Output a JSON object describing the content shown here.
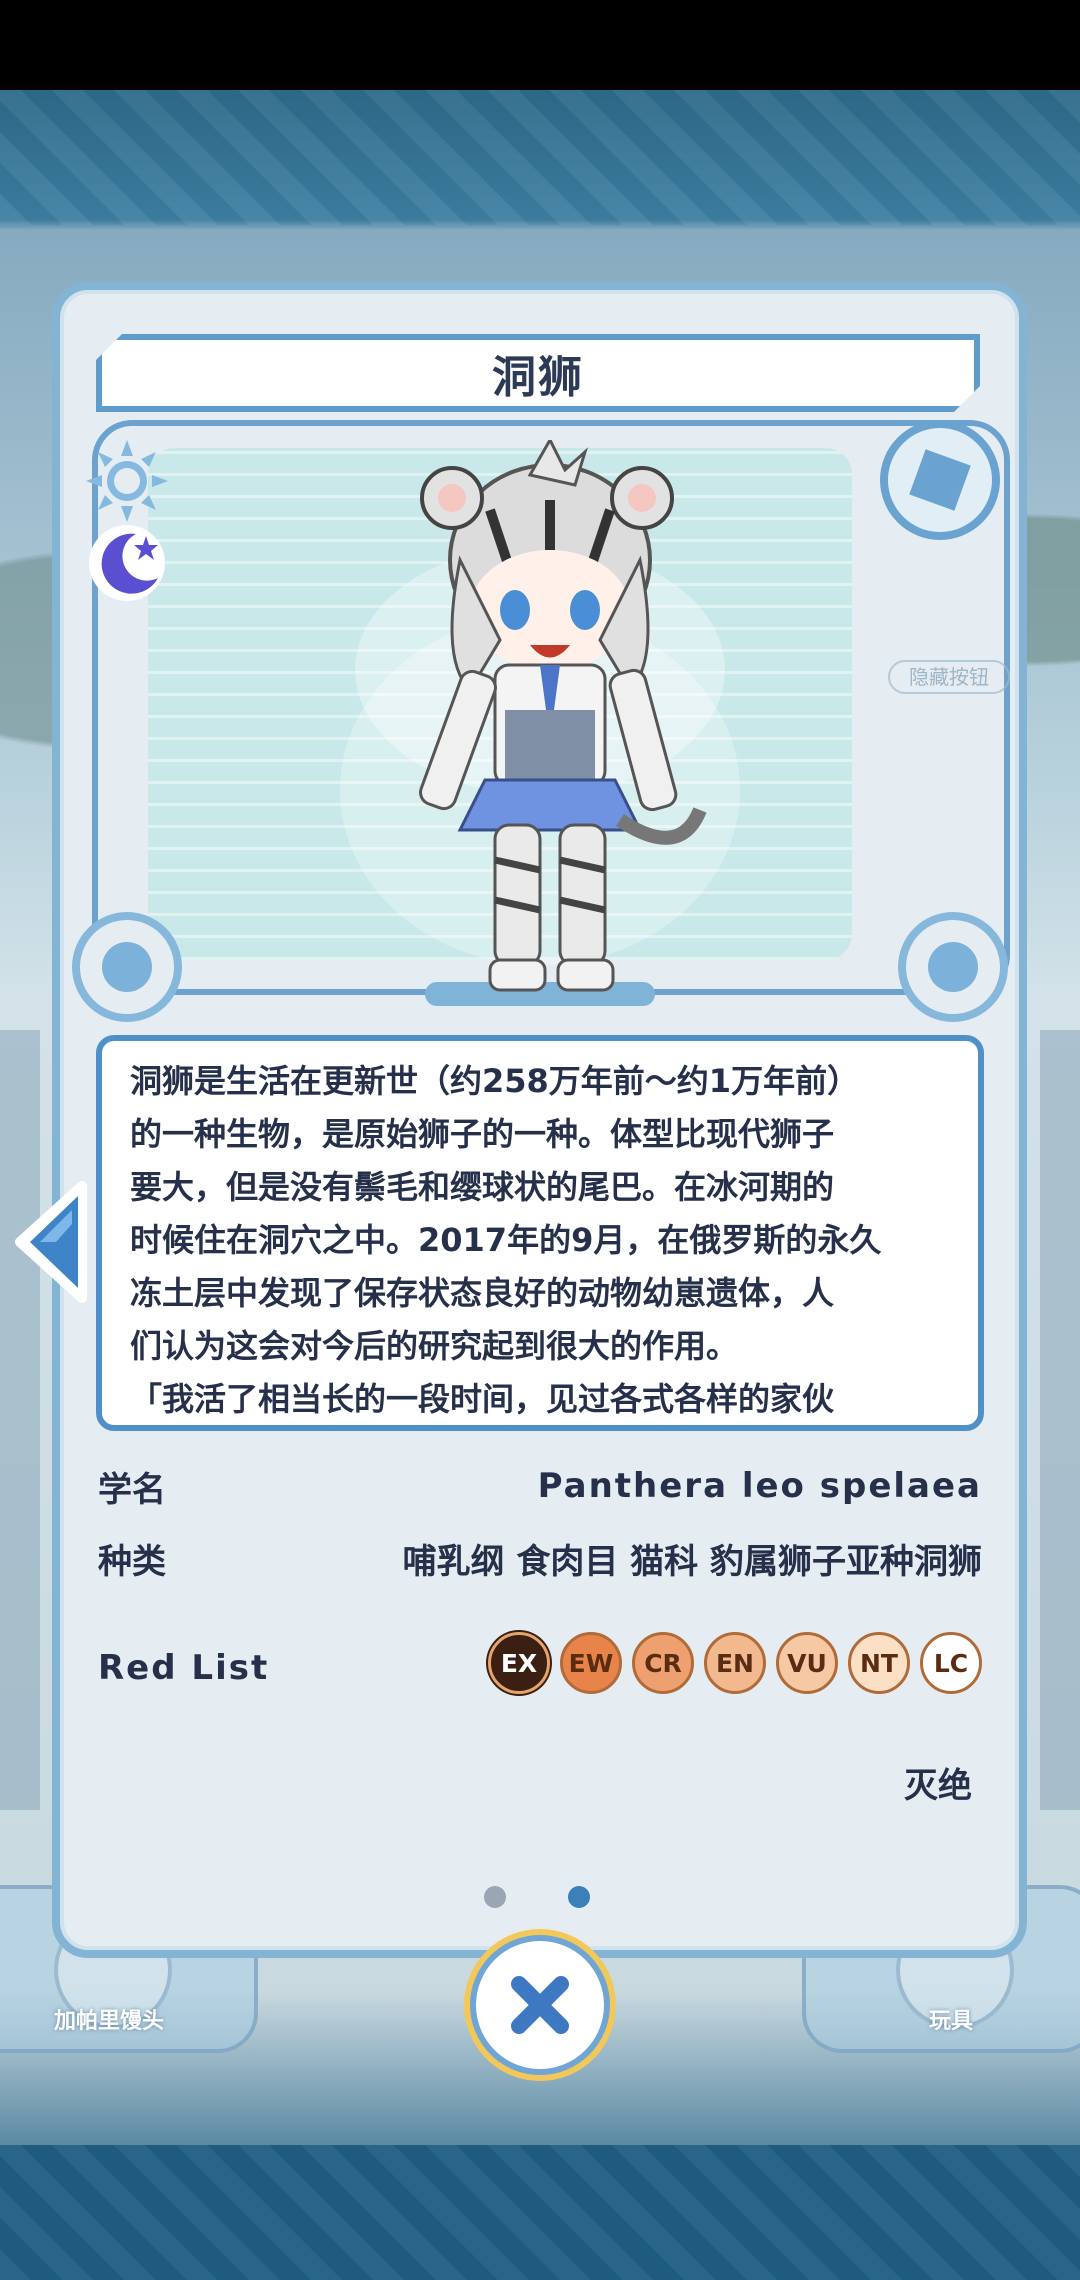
{
  "title": "洞狮",
  "description_lines": [
    "洞狮是生活在更新世（约258万年前～约1万年前）",
    "的一种生物，是原始狮子的一种。体型比现代狮子",
    "要大，但是没有鬃毛和缨球状的尾巴。在冰河期的",
    "时候住在洞穴之中。2017年的9月，在俄罗斯的永久",
    "冻土层中发现了保存状态良好的动物幼崽遗体，人",
    "们认为这会对今后的研究起到很大的作用。",
    "「我活了相当长的一段时间，见过各式各样的家伙"
  ],
  "scientific_name": {
    "label": "学名",
    "value": "Panthera leo spelaea"
  },
  "classification": {
    "label": "种类",
    "value": "哺乳纲 食肉目 猫科 豹属狮子亚种洞狮"
  },
  "red_list": {
    "label": "Red List",
    "status": "灭绝",
    "selected": "EX",
    "categories": [
      {
        "code": "EX",
        "bg": "#3a1f12",
        "fg": "#ffffff"
      },
      {
        "code": "EW",
        "bg": "#e8834a",
        "fg": "#5a2d12"
      },
      {
        "code": "CR",
        "bg": "#eea071",
        "fg": "#5a2d12"
      },
      {
        "code": "EN",
        "bg": "#f2b88e",
        "fg": "#5a2d12"
      },
      {
        "code": "VU",
        "bg": "#f6c8a4",
        "fg": "#5a2d12"
      },
      {
        "code": "NT",
        "bg": "#fbe0c5",
        "fg": "#5a2d12"
      },
      {
        "code": "LC",
        "bg": "#ffffff",
        "fg": "#5a2d12"
      }
    ]
  },
  "hint_label": "隐藏按钮",
  "page_dots": {
    "count": 2,
    "active": 1,
    "active_color": "#3d7fb8",
    "inactive_color": "#9aa6b4"
  },
  "bottom_tabs": {
    "left": "加帕里馒头",
    "right": "玩具"
  },
  "colors": {
    "accent": "#4f90c8",
    "text": "#26304a",
    "card_bg": "#e6edf2"
  }
}
